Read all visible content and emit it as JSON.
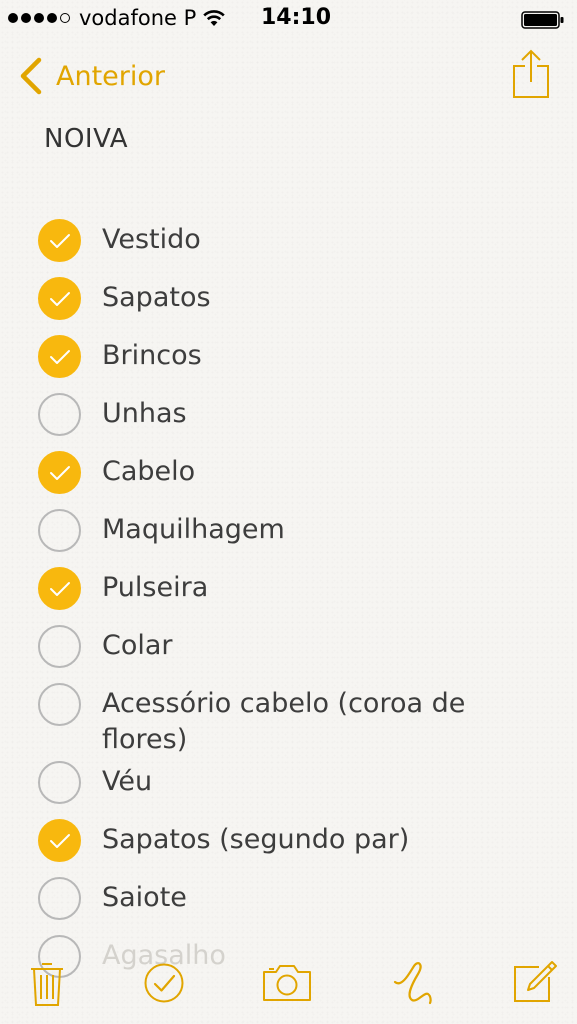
{
  "status_bar": {
    "carrier": "vodafone P",
    "time": "14:10"
  },
  "nav": {
    "back_label": "Anterior",
    "back_icon": "chevron-left-icon",
    "share_icon": "share-icon"
  },
  "note": {
    "title": "NOIVA",
    "items": [
      {
        "label": "Vestido",
        "checked": true
      },
      {
        "label": "Sapatos",
        "checked": true
      },
      {
        "label": "Brincos",
        "checked": true
      },
      {
        "label": "Unhas",
        "checked": false
      },
      {
        "label": "Cabelo",
        "checked": true
      },
      {
        "label": "Maquilhagem",
        "checked": false
      },
      {
        "label": "Pulseira",
        "checked": true
      },
      {
        "label": "Colar",
        "checked": false
      },
      {
        "label": "Acessório cabelo (coroa de flores)",
        "checked": false
      },
      {
        "label": "Véu",
        "checked": false
      },
      {
        "label": "Sapatos (segundo par)",
        "checked": true
      },
      {
        "label": "Saiote",
        "checked": false
      },
      {
        "label": "Agasalho",
        "checked": false
      }
    ]
  },
  "toolbar": {
    "icons": [
      "trash-icon",
      "checklist-icon",
      "camera-icon",
      "sketch-icon",
      "compose-icon"
    ]
  },
  "colors": {
    "accent": "#e1a500",
    "check_fill": "#f8b80e",
    "paper": "#f6f5f2"
  }
}
